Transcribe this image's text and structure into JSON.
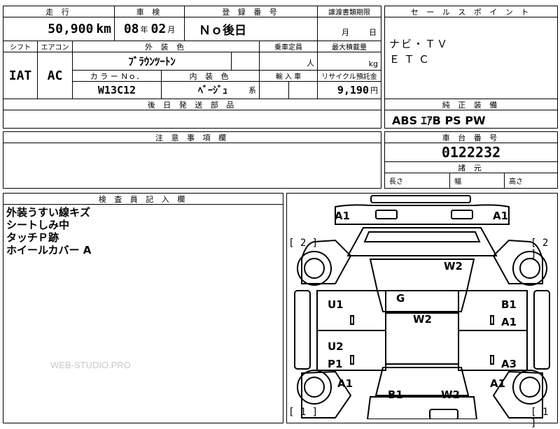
{
  "header": {
    "mileage_label": "走 行",
    "mileage_value": "50,900",
    "mileage_unit": "km",
    "inspection_label": "車 検",
    "inspection_year": "08",
    "inspection_year_unit": "年",
    "inspection_month": "02",
    "inspection_month_unit": "月",
    "registration_label": "登 録 番 号",
    "registration_value": "Ｎｏ後日",
    "transfer_label": "譲渡書類期限",
    "transfer_month_unit": "月",
    "transfer_day_unit": "日"
  },
  "spec": {
    "shift_label": "シフト",
    "shift_value": "IAT",
    "ac_label": "エアコン",
    "ac_value": "AC",
    "exterior_color_label": "外 装 色",
    "exterior_color_value": "ﾌﾞﾗｳﾝﾂｰﾄﾝ",
    "capacity_label": "乗車定員",
    "capacity_unit": "人",
    "max_load_label": "最大積載量",
    "max_load_unit": "kg",
    "color_no_label": "カ ラ ー Ｎｏ．",
    "color_no_value": "W13C12",
    "interior_color_label": "内 装 色",
    "interior_color_value": "ﾍﾞｰｼﾞｭ",
    "interior_color_suffix": "系",
    "import_label": "輸 入 車",
    "recycle_label": "リサイクル預託金",
    "recycle_value": "9,190",
    "recycle_unit": "円",
    "later_parts_label": "後 日 発 送 部 品"
  },
  "sales_point": {
    "label": "セ ー ル ス ポ イ ン ト",
    "lines": [
      "ナビ・ＴＶ",
      "ＥＴＣ"
    ]
  },
  "equipment": {
    "label": "純 正 装 備",
    "value": "ABS ｴｱB PS PW"
  },
  "caution": {
    "label": "注 意 事 項 欄"
  },
  "chassis": {
    "label": "車 台 番 号",
    "value": "0122232",
    "dims_label": "諸 元",
    "length_label": "長さ",
    "width_label": "幅",
    "height_label": "高さ"
  },
  "inspector": {
    "label": "検 査 員 記 入 欄",
    "notes": [
      "外装うすい線キズ",
      "シートしみ中",
      "タッチＰ跡",
      "ホイールカバー A"
    ]
  },
  "watermark": "WEB-STUDIO.PRO",
  "diagram": {
    "left_bracket_top": "[ 2 ]",
    "right_bracket_top": "[ 2 ]",
    "left_bracket_bottom": "[ 1 ]",
    "right_bracket_bottom": "[ 1 ]",
    "labels": {
      "front_left": "A1",
      "front_right": "A1",
      "windshield": "W2",
      "roof": "G",
      "roof_glass": "W2",
      "door_fl": "U1",
      "door_fr_1": "B1",
      "door_fr_2": "A1",
      "door_rl_1": "U2",
      "door_rl_2": "P1",
      "door_rr": "A3",
      "rear_left": "A1",
      "rear_right": "A1",
      "rear_bumper": "B1",
      "rear_glass": "W2"
    }
  }
}
